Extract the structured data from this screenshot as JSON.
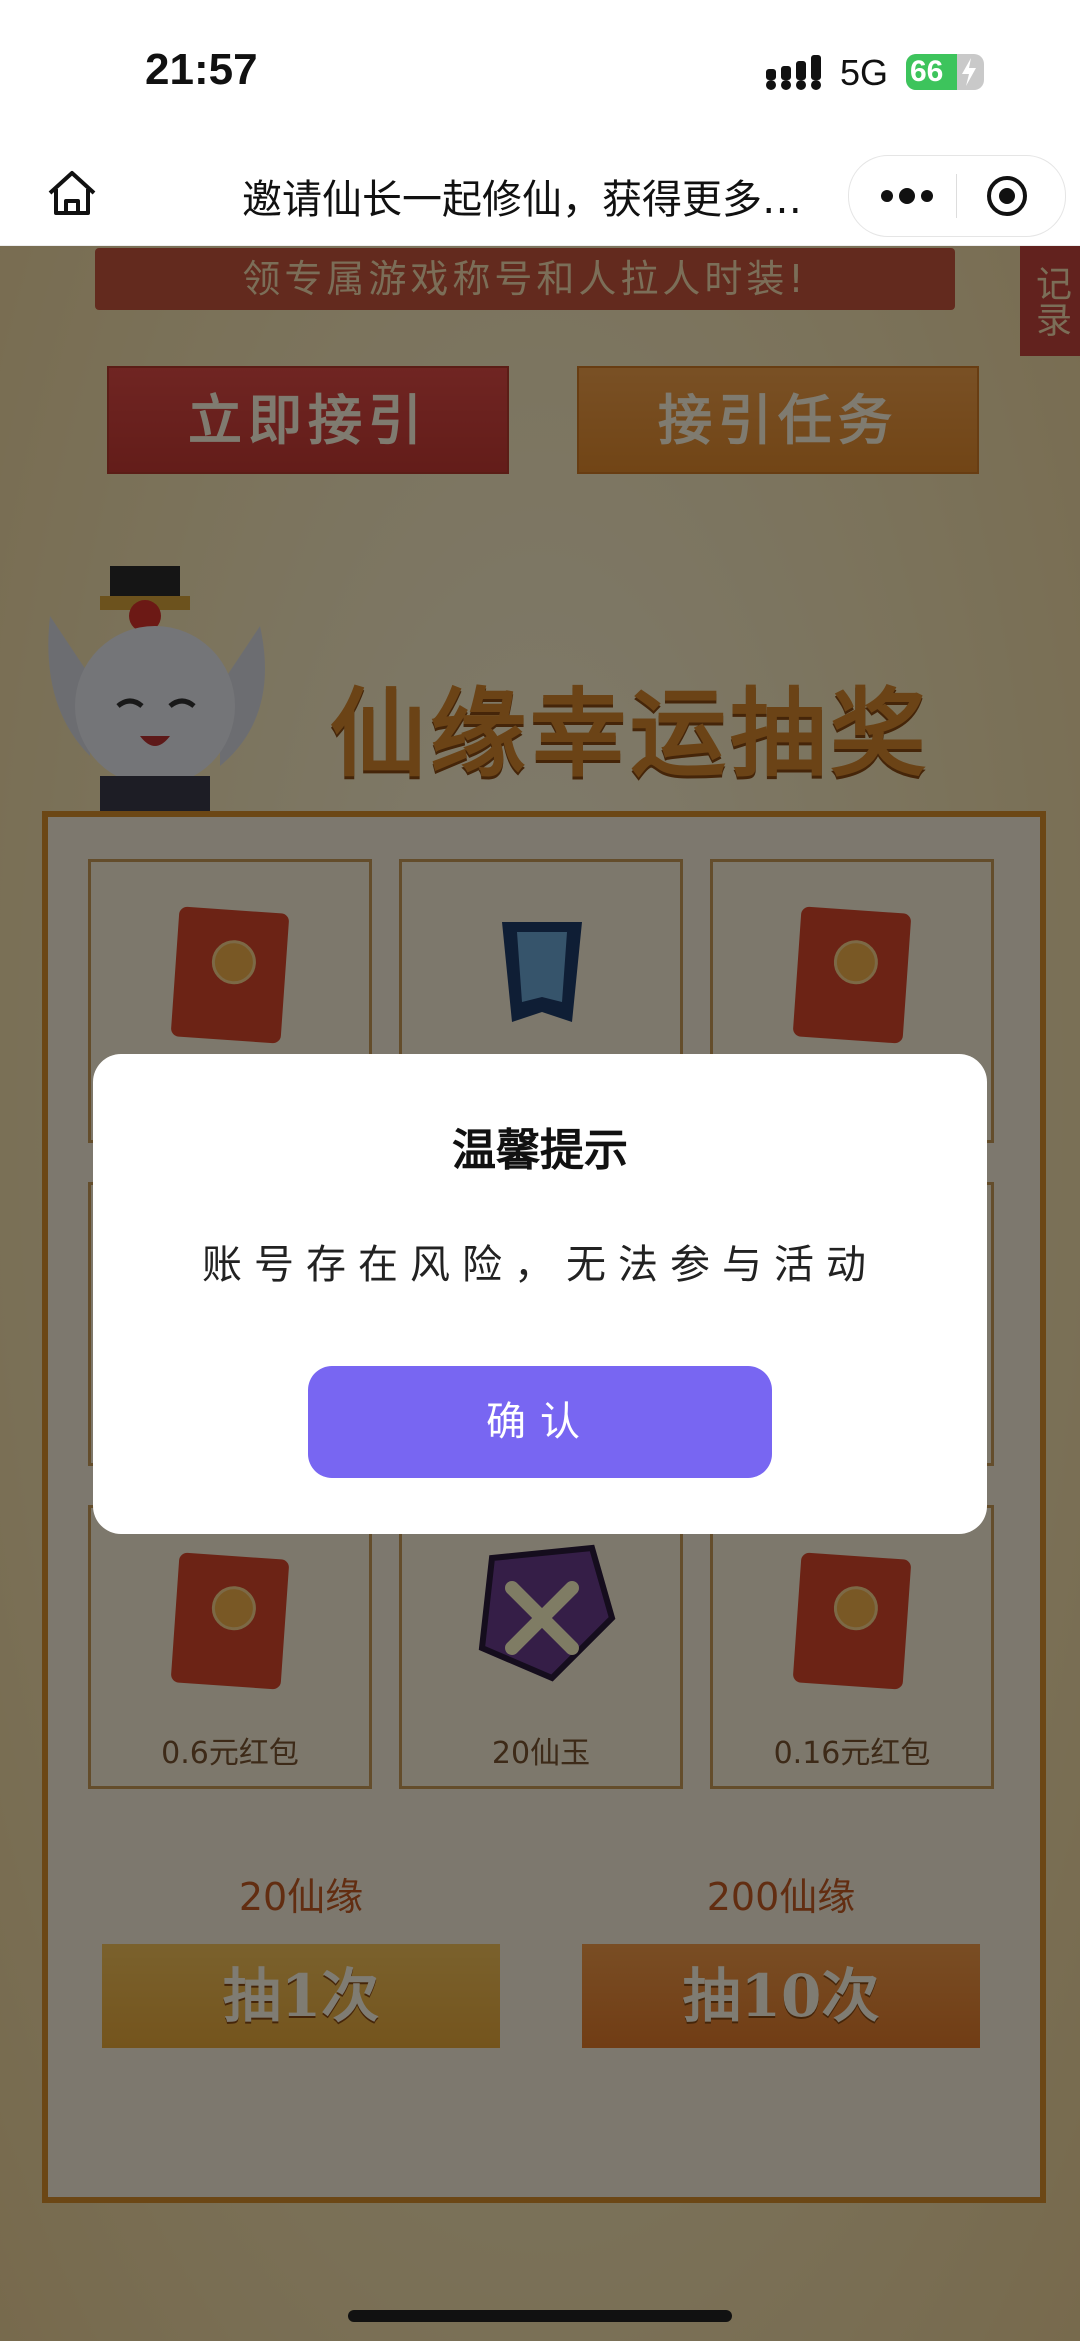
{
  "status_bar": {
    "time": "21:57",
    "network": "5G",
    "battery": 66
  },
  "nav": {
    "title": "邀请仙长一起修仙，获得更多…"
  },
  "page": {
    "banner": "领专属游戏称号和人拉人时装!",
    "record_label": "记录",
    "invite_button": "立即接引",
    "task_button": "接引任务",
    "lottery_title": "仙缘幸运抽奖",
    "grid_bottom_labels": [
      "0.6元红包",
      "20仙玉",
      "0.16元红包"
    ],
    "draw_options": [
      {
        "cost": "20仙缘",
        "label": "抽1次"
      },
      {
        "cost": "200仙缘",
        "label": "抽10次"
      }
    ]
  },
  "dialog": {
    "title": "温馨提示",
    "message": "账号存在风险，无法参与活动",
    "confirm": "确认"
  },
  "colors": {
    "accent": "#7866f2",
    "banner": "#c7553c",
    "frame": "#d98f2a"
  }
}
